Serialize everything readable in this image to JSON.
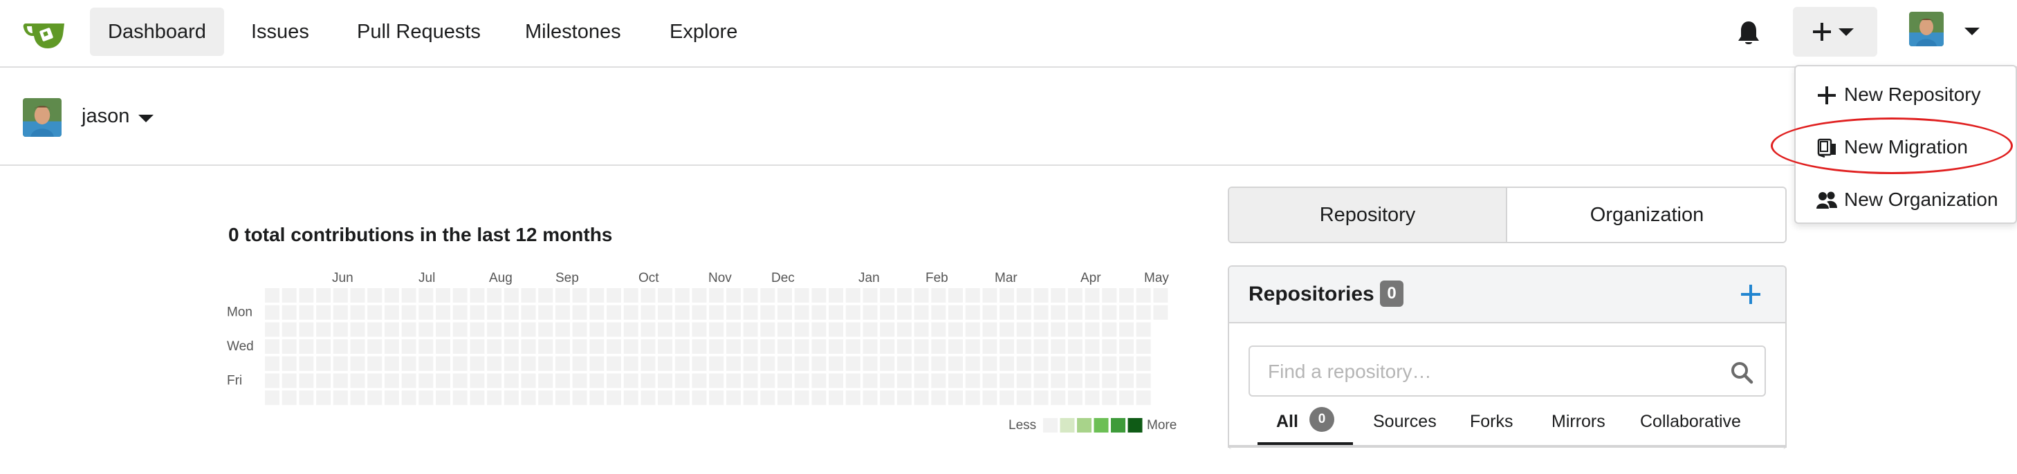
{
  "nav": {
    "items": [
      {
        "label": "Dashboard",
        "active": true
      },
      {
        "label": "Issues"
      },
      {
        "label": "Pull Requests"
      },
      {
        "label": "Milestones"
      },
      {
        "label": "Explore"
      }
    ],
    "logo_icon": "gitea-teacup-logo",
    "notification_icon": "bell-icon",
    "create_icon": "plus-icon",
    "accent_color": "#609926"
  },
  "create_menu": {
    "items": [
      {
        "label": "New Repository",
        "icon": "plus-icon"
      },
      {
        "label": "New Migration",
        "icon": "repo-push-icon",
        "highlighted": true
      },
      {
        "label": "New Organization",
        "icon": "organization-icon"
      }
    ],
    "highlight_color": "#e02020"
  },
  "user": {
    "name": "jason"
  },
  "heatmap": {
    "title": "0 total contributions in the last 12 months",
    "months": [
      "Jun",
      "Jul",
      "Aug",
      "Sep",
      "Oct",
      "Nov",
      "Dec",
      "Jan",
      "Feb",
      "Mar",
      "Apr",
      "May"
    ],
    "days": [
      "Mon",
      "Wed",
      "Fri"
    ],
    "legend_less": "Less",
    "legend_more": "More",
    "empty_color": "#f2f2f2",
    "scale_colors": [
      "#f2f2f2",
      "#d6e8c4",
      "#a8d38a",
      "#6cbf55",
      "#3e9b3a",
      "#0f5b16"
    ]
  },
  "panel": {
    "tabs": [
      {
        "label": "Repository",
        "active": true
      },
      {
        "label": "Organization"
      }
    ],
    "repositories": {
      "title": "Repositories",
      "count": "0",
      "add_icon": "plus-icon",
      "add_color": "#2185d0",
      "search_placeholder": "Find a repository…",
      "search_icon": "search-icon",
      "filters": [
        {
          "label": "All",
          "count": "0",
          "active": true
        },
        {
          "label": "Sources"
        },
        {
          "label": "Forks"
        },
        {
          "label": "Mirrors"
        },
        {
          "label": "Collaborative"
        }
      ]
    }
  }
}
